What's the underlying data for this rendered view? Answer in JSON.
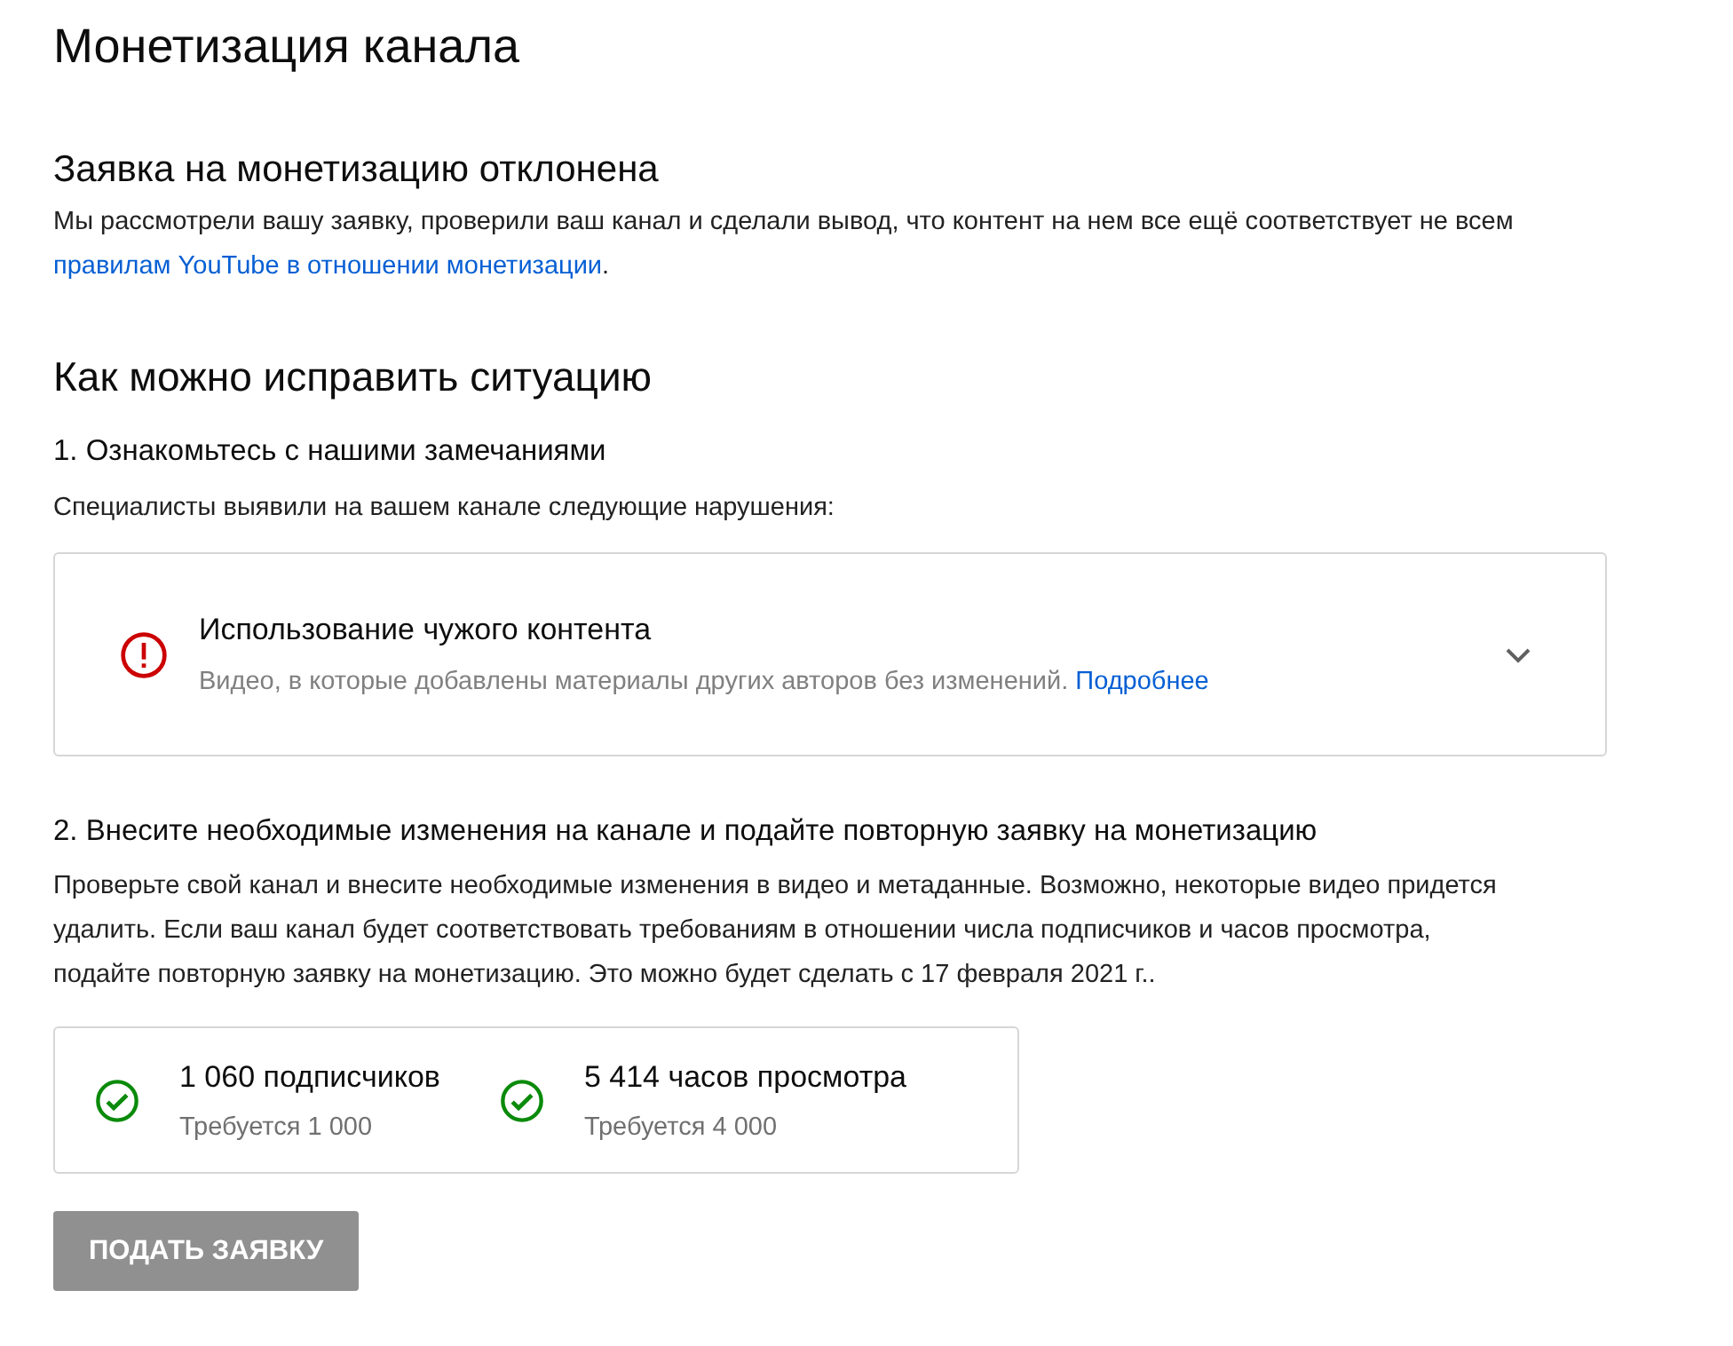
{
  "page_title": "Монетизация канала",
  "status": {
    "heading": "Заявка на монетизацию отклонена",
    "text_before": "Мы рассмотрели вашу заявку, проверили ваш канал и сделали вывод, что контент на нем все ещё соответствует не всем ",
    "link": "правилам YouTube в отношении монетизации",
    "text_after": "."
  },
  "fix_heading": "Как можно исправить ситуацию",
  "step_1": {
    "heading": "1. Ознакомьтесь с нашими замечаниями",
    "text": "Специалисты выявили на вашем канале следующие нарушения:"
  },
  "violations": [
    {
      "title": "Использование чужого контента",
      "description": "Видео, в которые добавлены материалы других авторов без изменений.",
      "link": "Подробнее",
      "expanded": false
    }
  ],
  "step_2": {
    "heading": "2. Внесите необходимые изменения на канале и подайте повторную заявку на монетизацию",
    "text": "Проверьте свой канал и внесите необходимые изменения в видео и метаданные. Возможно, некоторые видео придется удалить. Если ваш канал будет соответствовать требованиям в отношении числа подписчиков и часов просмотра, подайте повторную заявку на монетизацию. Это можно будет сделать с 17 февраля 2021 г.."
  },
  "requirements": [
    {
      "value": "1 060 подписчиков",
      "required": "Требуется 1 000",
      "met": true
    },
    {
      "value": "5 414 часов просмотра",
      "required": "Требуется 4 000",
      "met": true
    }
  ],
  "apply_button": {
    "label": "ПОДАТЬ ЗАЯВКУ",
    "disabled": true
  }
}
